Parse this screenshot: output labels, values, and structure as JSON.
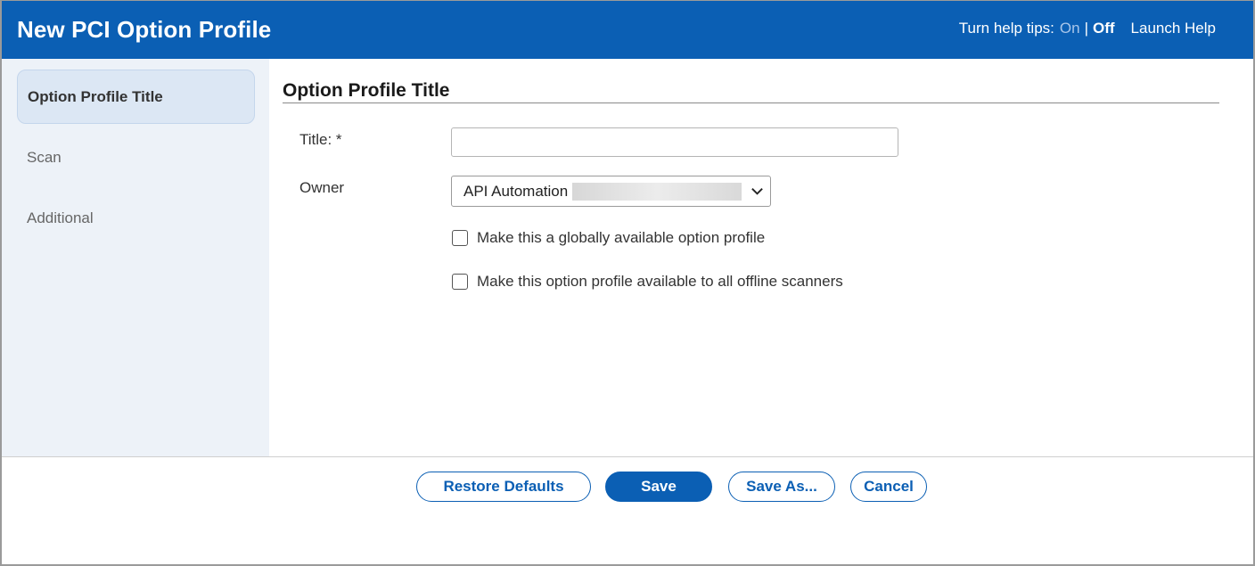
{
  "header": {
    "title": "New PCI Option Profile",
    "help_tips_label": "Turn help tips:",
    "help_tips_on": "On",
    "help_tips_separator": "|",
    "help_tips_off": "Off",
    "launch_help": "Launch Help"
  },
  "sidebar": {
    "items": [
      {
        "label": "Option Profile Title",
        "active": true
      },
      {
        "label": "Scan",
        "active": false
      },
      {
        "label": "Additional",
        "active": false
      }
    ]
  },
  "main": {
    "section_title": "Option Profile Title",
    "title_field": {
      "label": "Title: *",
      "value": "",
      "placeholder": ""
    },
    "owner_field": {
      "label": "Owner",
      "selected": "API Automation",
      "icon": "chevron-down-icon"
    },
    "checkboxes": [
      {
        "label": "Make this a globally available option profile",
        "checked": false
      },
      {
        "label": "Make this option profile available to all offline scanners",
        "checked": false
      }
    ]
  },
  "footer": {
    "restore_defaults": "Restore Defaults",
    "save": "Save",
    "save_as": "Save As...",
    "cancel": "Cancel"
  },
  "colors": {
    "brand_blue": "#0b5fb4",
    "sidebar_bg": "#edf2f8",
    "active_item_bg": "#dce7f4"
  }
}
